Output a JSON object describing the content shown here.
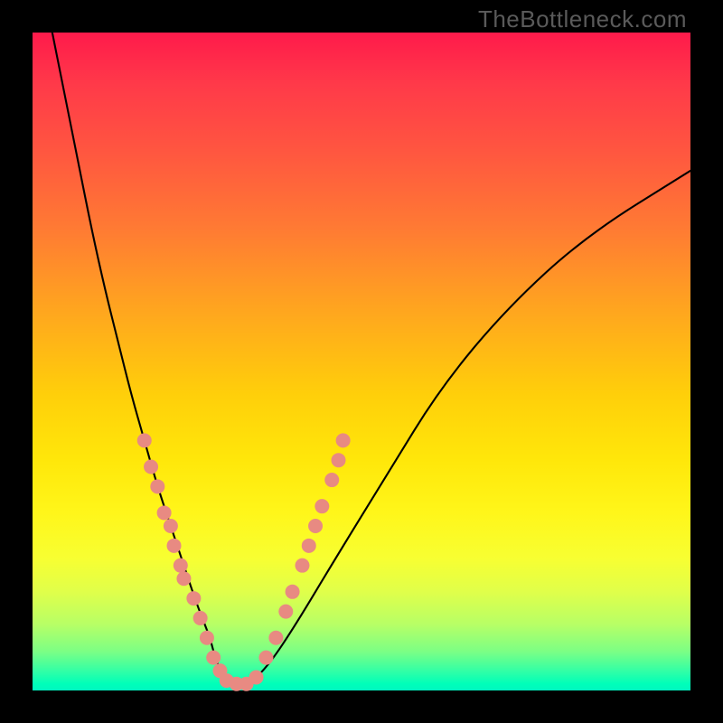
{
  "attribution": "TheBottleneck.com",
  "chart_data": {
    "type": "line",
    "title": "",
    "xlabel": "",
    "ylabel": "",
    "xlim": [
      0,
      100
    ],
    "ylim": [
      0,
      100
    ],
    "axes_visible": false,
    "grid": false,
    "background": "rainbow-vertical-gradient",
    "series": [
      {
        "name": "bottleneck-curve",
        "color": "#000000",
        "x": [
          3,
          5,
          7,
          9,
          11,
          13,
          15,
          17,
          19,
          21,
          23,
          25,
          27,
          28,
          30,
          33,
          36,
          40,
          46,
          54,
          62,
          72,
          84,
          100
        ],
        "y": [
          100,
          90,
          80,
          70,
          61,
          53,
          45,
          38,
          31,
          25,
          19,
          13,
          8,
          4,
          1,
          1,
          4,
          10,
          20,
          33,
          46,
          58,
          69,
          79
        ]
      }
    ],
    "markers": {
      "name": "sample-points",
      "color": "#e88a82",
      "shape": "circle",
      "radius_px": 8,
      "points": [
        {
          "x": 17,
          "y": 38
        },
        {
          "x": 18,
          "y": 34
        },
        {
          "x": 19,
          "y": 31
        },
        {
          "x": 20,
          "y": 27
        },
        {
          "x": 21,
          "y": 25
        },
        {
          "x": 21.5,
          "y": 22
        },
        {
          "x": 22.5,
          "y": 19
        },
        {
          "x": 23,
          "y": 17
        },
        {
          "x": 24.5,
          "y": 14
        },
        {
          "x": 25.5,
          "y": 11
        },
        {
          "x": 26.5,
          "y": 8
        },
        {
          "x": 27.5,
          "y": 5
        },
        {
          "x": 28.5,
          "y": 3
        },
        {
          "x": 29.5,
          "y": 1.5
        },
        {
          "x": 31,
          "y": 1
        },
        {
          "x": 32.5,
          "y": 1
        },
        {
          "x": 34,
          "y": 2
        },
        {
          "x": 35.5,
          "y": 5
        },
        {
          "x": 37,
          "y": 8
        },
        {
          "x": 38.5,
          "y": 12
        },
        {
          "x": 39.5,
          "y": 15
        },
        {
          "x": 41,
          "y": 19
        },
        {
          "x": 42,
          "y": 22
        },
        {
          "x": 43,
          "y": 25
        },
        {
          "x": 44,
          "y": 28
        },
        {
          "x": 45.5,
          "y": 32
        },
        {
          "x": 46.5,
          "y": 35
        },
        {
          "x": 47.2,
          "y": 38
        }
      ]
    }
  }
}
